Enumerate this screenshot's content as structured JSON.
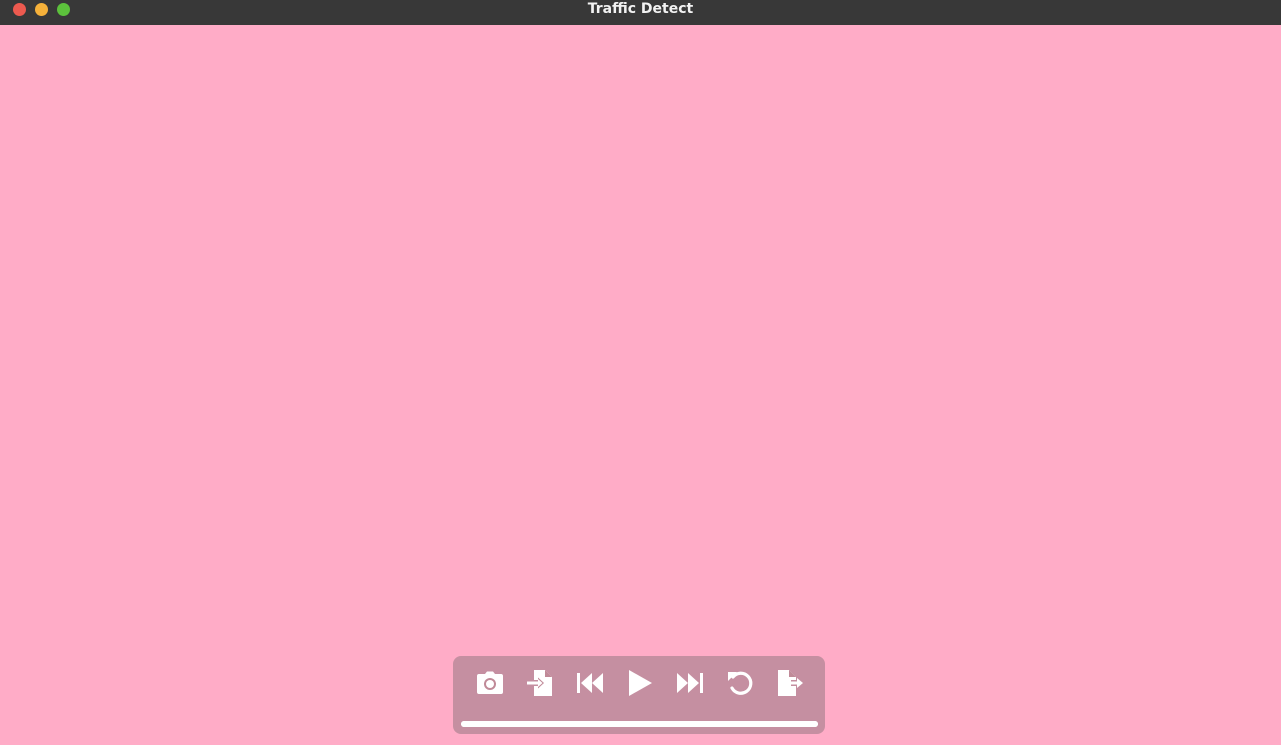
{
  "window": {
    "title": "Traffic Detect"
  },
  "controls": {
    "buttons": [
      {
        "name": "snapshot",
        "icon": "camera-icon"
      },
      {
        "name": "open-file",
        "icon": "file-import-icon"
      },
      {
        "name": "previous",
        "icon": "skip-back-icon"
      },
      {
        "name": "play",
        "icon": "play-icon"
      },
      {
        "name": "next",
        "icon": "skip-forward-icon"
      },
      {
        "name": "replay",
        "icon": "rotate-left-icon"
      },
      {
        "name": "export",
        "icon": "file-export-icon"
      }
    ],
    "progress_fraction": 1.0
  },
  "colors": {
    "background": "#ffacc7",
    "titlebar": "#383838",
    "close": "#ed5a4f",
    "minimize": "#f5b13a",
    "maximize": "#5cc13c",
    "icon": "#ffffff"
  }
}
